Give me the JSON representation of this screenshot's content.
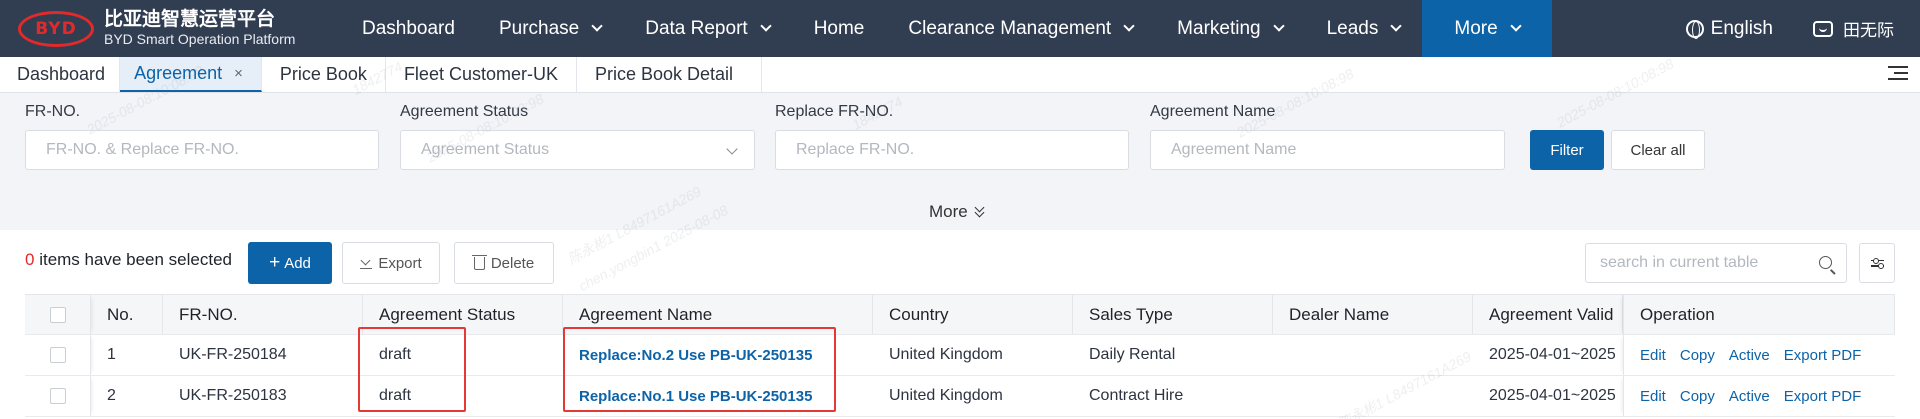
{
  "brand": {
    "logo_text": "BYD",
    "name_cn": "比亚迪智慧运营平台",
    "name_en": "BYD Smart Operation Platform"
  },
  "nav": {
    "items": [
      {
        "label": "Dashboard"
      },
      {
        "label": "Purchase"
      },
      {
        "label": "Data Report"
      },
      {
        "label": "Home"
      },
      {
        "label": "Clearance Management"
      },
      {
        "label": "Marketing"
      },
      {
        "label": "Leads"
      },
      {
        "label": "More"
      }
    ],
    "language": "English",
    "user": "田无际"
  },
  "tabs": [
    {
      "label": "Dashboard"
    },
    {
      "label": "Agreement",
      "close": "×"
    },
    {
      "label": "Price Book"
    },
    {
      "label": "Fleet Customer-UK"
    },
    {
      "label": "Price Book Detail"
    }
  ],
  "filters": {
    "fr_no": {
      "label": "FR-NO.",
      "placeholder": "FR-NO. & Replace FR-NO."
    },
    "status": {
      "label": "Agreement Status",
      "placeholder": "Agreement Status"
    },
    "replace_fr": {
      "label": "Replace FR-NO.",
      "placeholder": "Replace FR-NO."
    },
    "name": {
      "label": "Agreement Name",
      "placeholder": "Agreement Name"
    },
    "filter_btn": "Filter",
    "clear_btn": "Clear all",
    "more": "More"
  },
  "toolbar": {
    "selected_count": "0",
    "selected_text": " items have been selected",
    "add": "Add",
    "export": "Export",
    "delete": "Delete",
    "search_placeholder": "search in current table"
  },
  "table": {
    "headers": {
      "no": "No.",
      "fr": "FR-NO.",
      "status": "Agreement Status",
      "name": "Agreement Name",
      "country": "Country",
      "sales": "Sales Type",
      "dealer": "Dealer Name",
      "valid": "Agreement Valid",
      "op": "Operation"
    },
    "rows": [
      {
        "no": "1",
        "fr": "UK-FR-250184",
        "status": "draft",
        "name": "Replace:No.2 Use PB-UK-250135",
        "country": "United Kingdom",
        "sales": "Daily Rental",
        "dealer": "",
        "valid": "2025-04-01~2025"
      },
      {
        "no": "2",
        "fr": "UK-FR-250183",
        "status": "draft",
        "name": "Replace:No.1 Use PB-UK-250135",
        "country": "United Kingdom",
        "sales": "Contract Hire",
        "dealer": "",
        "valid": "2025-04-01~2025"
      }
    ],
    "ops": {
      "edit": "Edit",
      "copy": "Copy",
      "active": "Active",
      "export_pdf": "Export PDF"
    }
  },
  "watermark": {
    "id": "1842774",
    "date": "2025-08-08:10:08:98",
    "name": "陈永彬1 L8497161A269",
    "user": "chen.yongbin1 2025-08-08"
  }
}
